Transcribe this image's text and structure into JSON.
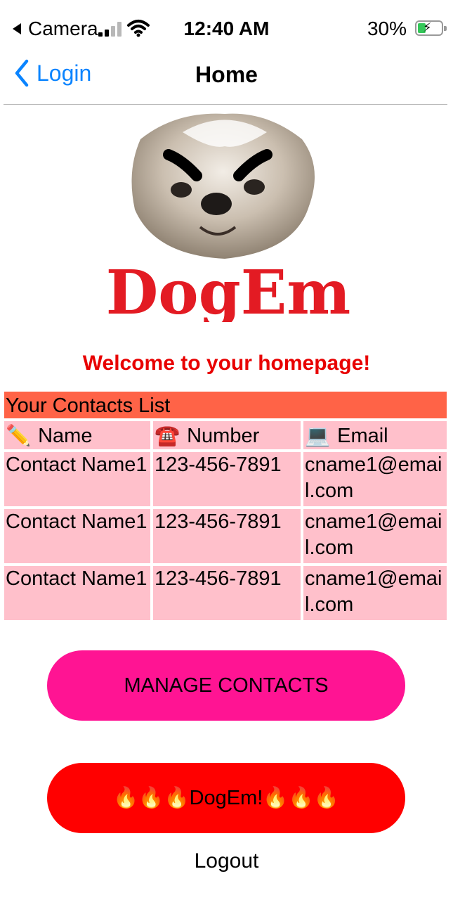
{
  "status_bar": {
    "back_app": "Camera",
    "time": "12:40 AM",
    "battery": "30%"
  },
  "nav": {
    "back_label": "Login",
    "title": "Home"
  },
  "logo": {
    "text": "DogEm"
  },
  "welcome": "Welcome to your homepage!",
  "contacts": {
    "title": "Your Contacts List",
    "columns": [
      {
        "icon": "✏️",
        "label": "Name"
      },
      {
        "icon": "☎️",
        "label": "Number"
      },
      {
        "icon": "💻",
        "label": "Email"
      }
    ],
    "rows": [
      {
        "name": "Contact Name1",
        "number": "123-456-7891",
        "email": "cname1@email.com"
      },
      {
        "name": "Contact Name1",
        "number": "123-456-7891",
        "email": "cname1@email.com"
      },
      {
        "name": "Contact Name1",
        "number": "123-456-7891",
        "email": "cname1@email.com"
      }
    ]
  },
  "buttons": {
    "manage": "MANAGE CONTACTS",
    "dogem": "🔥🔥🔥DogEm!🔥🔥🔥",
    "logout": "Logout"
  },
  "colors": {
    "accent_link": "#0a84ff",
    "welcome_text": "#e80000",
    "table_title_bg": "#ff6347",
    "table_cell_bg": "#ffc0cb",
    "manage_button": "#ff1493",
    "dogem_button": "#ff0000"
  }
}
